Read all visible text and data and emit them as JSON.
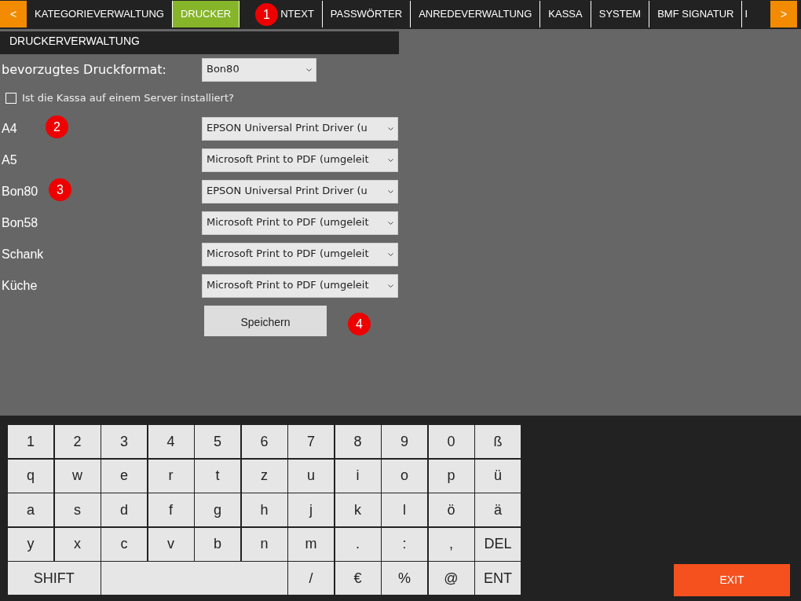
{
  "nav": {
    "prev": "<",
    "next": ">"
  },
  "tabs": [
    {
      "label": "KATEGORIEVERWALTUNG",
      "selected": false
    },
    {
      "label": "DRUCKER",
      "selected": true
    },
    {
      "label": "NTEXT",
      "selected": false
    },
    {
      "label": "PASSWÖRTER",
      "selected": false
    },
    {
      "label": "ANREDEVERWALTUNG",
      "selected": false
    },
    {
      "label": "KASSA",
      "selected": false
    },
    {
      "label": "SYSTEM",
      "selected": false
    },
    {
      "label": "BMF SIGNATUR",
      "selected": false
    },
    {
      "label": "I",
      "selected": false
    }
  ],
  "panel_title": "DRUCKERVERWALTUNG",
  "preferred_format": {
    "label": "bevorzugtes Druckformat:",
    "value": "Bon80"
  },
  "server_checkbox": {
    "label": "Ist die Kassa auf einem Server installiert?",
    "checked": false
  },
  "printers": [
    {
      "label": "A4",
      "value": "EPSON Universal Print Driver (u"
    },
    {
      "label": "A5",
      "value": "Microsoft Print to PDF (umgeleit"
    },
    {
      "label": "Bon80",
      "value": "EPSON Universal Print Driver (u"
    },
    {
      "label": "Bon58",
      "value": "Microsoft Print to PDF (umgeleit"
    },
    {
      "label": "Schank",
      "value": "Microsoft Print to PDF (umgeleit"
    },
    {
      "label": "Küche",
      "value": "Microsoft Print to PDF (umgeleit"
    }
  ],
  "save_button": "Speichern",
  "keyboard": [
    [
      {
        "kind": "key",
        "label": "1"
      },
      {
        "kind": "key",
        "label": "2"
      },
      {
        "kind": "key",
        "label": "3"
      },
      {
        "kind": "key",
        "label": "4"
      },
      {
        "kind": "key",
        "label": "5"
      },
      {
        "kind": "key",
        "label": "6"
      },
      {
        "kind": "key",
        "label": "7"
      },
      {
        "kind": "key",
        "label": "8"
      },
      {
        "kind": "key",
        "label": "9"
      },
      {
        "kind": "key",
        "label": "0"
      },
      {
        "kind": "key",
        "label": "ß"
      }
    ],
    [
      {
        "kind": "key",
        "label": "q"
      },
      {
        "kind": "key",
        "label": "w"
      },
      {
        "kind": "key",
        "label": "e"
      },
      {
        "kind": "key",
        "label": "r"
      },
      {
        "kind": "key",
        "label": "t"
      },
      {
        "kind": "key",
        "label": "z"
      },
      {
        "kind": "key",
        "label": "u"
      },
      {
        "kind": "key",
        "label": "i"
      },
      {
        "kind": "key",
        "label": "o"
      },
      {
        "kind": "key",
        "label": "p"
      },
      {
        "kind": "key",
        "label": "ü"
      }
    ],
    [
      {
        "kind": "key",
        "label": "a"
      },
      {
        "kind": "key",
        "label": "s"
      },
      {
        "kind": "key",
        "label": "d"
      },
      {
        "kind": "key",
        "label": "f"
      },
      {
        "kind": "key",
        "label": "g"
      },
      {
        "kind": "key",
        "label": "h"
      },
      {
        "kind": "key",
        "label": "j"
      },
      {
        "kind": "key",
        "label": "k"
      },
      {
        "kind": "key",
        "label": "l"
      },
      {
        "kind": "key",
        "label": "ö"
      },
      {
        "kind": "key",
        "label": "ä"
      }
    ],
    [
      {
        "kind": "key",
        "label": "y"
      },
      {
        "kind": "key",
        "label": "x"
      },
      {
        "kind": "key",
        "label": "c"
      },
      {
        "kind": "key",
        "label": "v"
      },
      {
        "kind": "key",
        "label": "b"
      },
      {
        "kind": "key",
        "label": "n"
      },
      {
        "kind": "key",
        "label": "m"
      },
      {
        "kind": "key",
        "label": "."
      },
      {
        "kind": "key",
        "label": ":"
      },
      {
        "kind": "key",
        "label": ","
      },
      {
        "kind": "key",
        "label": "DEL"
      }
    ],
    [
      {
        "kind": "wide",
        "label": "SHIFT"
      },
      {
        "kind": "space"
      },
      {
        "kind": "key",
        "label": "/"
      },
      {
        "kind": "key",
        "label": "€"
      },
      {
        "kind": "key",
        "label": "%"
      },
      {
        "kind": "key",
        "label": "@"
      },
      {
        "kind": "key",
        "label": "ENT"
      }
    ]
  ],
  "exit_button": "EXIT",
  "annotations": [
    {
      "label": "1"
    },
    {
      "label": "2"
    },
    {
      "label": "3"
    },
    {
      "label": "4"
    }
  ]
}
